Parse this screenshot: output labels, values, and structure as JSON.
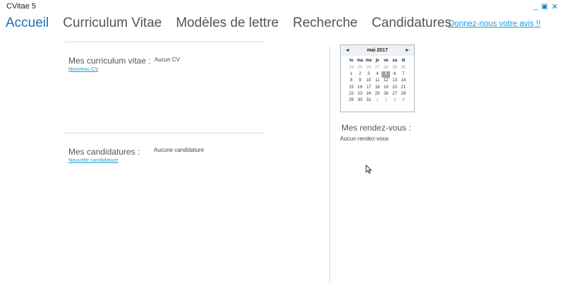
{
  "app": {
    "title": "CVitae 5"
  },
  "window": {
    "minimize": "_",
    "restore": "▣",
    "close": "✕"
  },
  "nav": {
    "items": [
      "Accueil",
      "Curriculum Vitae",
      "Modèles de lettre",
      "Recherche",
      "Candidatures"
    ],
    "feedback": "Donnez-nous votre avis !!"
  },
  "cv_section": {
    "label": "Mes curriculum vitae :",
    "link": "Nouveau CV",
    "value": "Aucun CV"
  },
  "applications_section": {
    "label": "Mes candidatures :",
    "link": "Nouvelle candidature",
    "value": "Aucune candidature"
  },
  "calendar": {
    "month": "mai 2017",
    "prev": "◄",
    "next": "►",
    "weekdays": [
      "lu",
      "ma",
      "me",
      "je",
      "ve",
      "sa",
      "di"
    ],
    "weeks": [
      [
        "24",
        "25",
        "26",
        "27",
        "28",
        "29",
        "30"
      ],
      [
        "1",
        "2",
        "3",
        "4",
        "5",
        "6",
        "7"
      ],
      [
        "8",
        "9",
        "10",
        "11",
        "12",
        "13",
        "14"
      ],
      [
        "15",
        "16",
        "17",
        "18",
        "19",
        "20",
        "21"
      ],
      [
        "22",
        "23",
        "24",
        "25",
        "26",
        "27",
        "28"
      ],
      [
        "29",
        "30",
        "31",
        "1",
        "2",
        "3",
        "4"
      ]
    ],
    "selected": "5"
  },
  "appointments": {
    "label": "Mes rendez-vous :",
    "value": "Aucun rendez-vous"
  },
  "colors": {
    "accent": "#1a6fb5",
    "link": "#1a9fd8",
    "selected_day": "#9aa3ad"
  }
}
